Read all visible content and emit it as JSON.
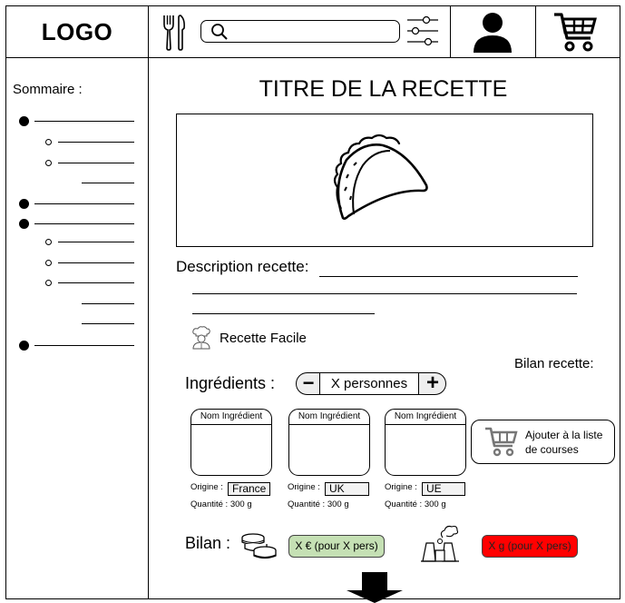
{
  "header": {
    "logo": "LOGO",
    "icons": [
      "utensils-icon",
      "search-icon",
      "filter-sliders-icon",
      "user-icon",
      "cart-icon"
    ]
  },
  "sidebar": {
    "title": "Sommaire :"
  },
  "recipe": {
    "title": "TITRE DE LA RECETTE",
    "description_label": "Description recette:",
    "difficulty": "Recette Facile",
    "bilan_recette_label": "Bilan recette:",
    "ingredients_label": "Ingrédients :",
    "persons": "X personnes",
    "stepper_minus": "−",
    "stepper_plus": "+",
    "ingredients": [
      {
        "name": "Nom Ingrédient",
        "origin_label": "Origine :",
        "origin": "France",
        "quantity": "Quantité : 300 g"
      },
      {
        "name": "Nom Ingrédient",
        "origin_label": "Origine :",
        "origin": "UK",
        "quantity": "Quantité : 300 g"
      },
      {
        "name": "Nom Ingrédient",
        "origin_label": "Origine :",
        "origin": "UE",
        "quantity": "Quantité : 300 g"
      }
    ],
    "add_to_list": "Ajouter à la liste de courses",
    "bilan_label": "Bilan :",
    "cost": "X € (pour X pers)",
    "co2": "X g (pour X pers)"
  },
  "colors": {
    "cost_bg": "#c5e0b4",
    "co2_bg": "#ff0000"
  }
}
